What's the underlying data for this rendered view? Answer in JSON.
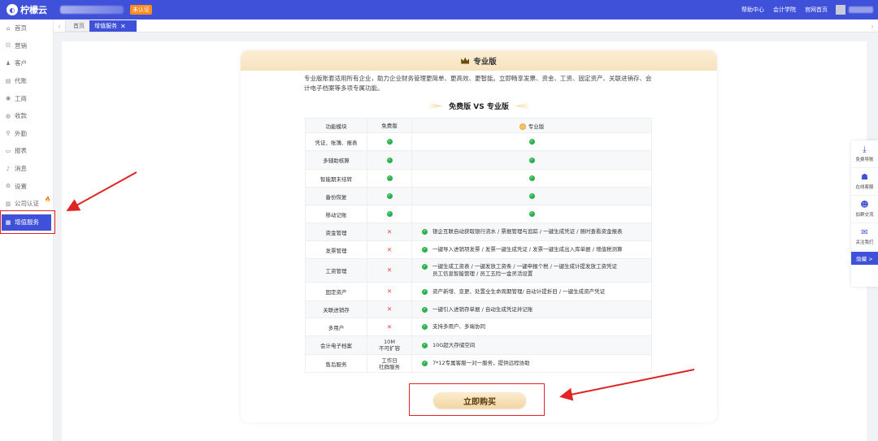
{
  "app": {
    "brand": "柠檬云",
    "badge": "未认证",
    "top_links": [
      "帮助中心",
      "会计学院",
      "官网首页"
    ]
  },
  "sidebar": {
    "items": [
      {
        "label": "首页",
        "icon": "home-icon",
        "glyph": "⌂"
      },
      {
        "label": "营销",
        "icon": "marketing-icon",
        "glyph": "☷"
      },
      {
        "label": "客户",
        "icon": "customer-icon",
        "glyph": "♟"
      },
      {
        "label": "代账",
        "icon": "bookkeeping-icon",
        "glyph": "▤"
      },
      {
        "label": "工商",
        "icon": "business-icon",
        "glyph": "◉"
      },
      {
        "label": "收款",
        "icon": "payment-icon",
        "glyph": "◍"
      },
      {
        "label": "外勤",
        "icon": "field-icon",
        "glyph": "⚲"
      },
      {
        "label": "报表",
        "icon": "report-icon",
        "glyph": "▭"
      },
      {
        "label": "消息",
        "icon": "bell-icon",
        "glyph": "♪"
      },
      {
        "label": "设置",
        "icon": "gear-icon",
        "glyph": "⚙"
      },
      {
        "label": "公司认证",
        "icon": "certify-icon",
        "glyph": "▥"
      },
      {
        "label": "增值服务",
        "icon": "value-added-icon",
        "glyph": "▦"
      }
    ]
  },
  "tabs": {
    "home": "首页",
    "current": "增值服务",
    "close": "✕",
    "prev": "‹",
    "next": "›"
  },
  "card": {
    "title": "专业版",
    "desc": "专业版账套适用所有企业，助力企业财务管理更简单、更高效、更智能。立即畅享发票、资金、工资、固定资产、关联进销存、会计电子档案等多项专属功能。",
    "vs_title": "免费版 VS 专业版",
    "headers": {
      "module": "功能模块",
      "free": "免费版",
      "pro": "专业版"
    },
    "rows": [
      {
        "module": "凭证、账簿、报表",
        "free": "check",
        "pro": "check",
        "pro_lines": []
      },
      {
        "module": "多辅助核算",
        "free": "check",
        "pro": "check",
        "pro_lines": []
      },
      {
        "module": "智能期末结转",
        "free": "check",
        "pro": "check",
        "pro_lines": []
      },
      {
        "module": "备份恢复",
        "free": "check",
        "pro": "check",
        "pro_lines": []
      },
      {
        "module": "移动记账",
        "free": "check",
        "pro": "check",
        "pro_lines": []
      },
      {
        "module": "资金管理",
        "free": "cross",
        "pro": "text",
        "pro_lines": [
          "银企互联自动获取银行流水 / 票据管理与追踪 / 一键生成凭证 / 随时查看资金报表"
        ]
      },
      {
        "module": "发票管理",
        "free": "cross",
        "pro": "text",
        "pro_lines": [
          "一键导入进销项发票 / 发票一键生成凭证 / 发票一键生成出入库单据 / 增值税测算"
        ]
      },
      {
        "module": "工资管理",
        "free": "cross",
        "pro": "text",
        "pro_lines": [
          "一键生成工资表 / 一键发放工资条 / 一键申报个税 / 一键生成计提发放工资凭证",
          "员工信息智能管理 / 员工五险一金灵活设置"
        ]
      },
      {
        "module": "固定资产",
        "free": "cross",
        "pro": "text",
        "pro_lines": [
          "资产新增、变更、处置全生命周期管理/ 自动计提折旧 / 一键生成资产凭证"
        ]
      },
      {
        "module": "关联进销存",
        "free": "cross",
        "pro": "text",
        "pro_lines": [
          "一键引入进销存单据 / 自动生成凭证并记账"
        ]
      },
      {
        "module": "多用户",
        "free": "cross",
        "pro": "text",
        "pro_lines": [
          "支持多用户、多端协同"
        ]
      },
      {
        "module": "会计电子档案",
        "free": "text",
        "free_lines": [
          "10M",
          "不可扩容"
        ],
        "pro": "text",
        "pro_lines": [
          "10G超大存储空间"
        ]
      },
      {
        "module": "售后服务",
        "free": "text",
        "free_lines": [
          "工作日",
          "社群服务"
        ],
        "pro": "text",
        "pro_lines": [
          "7*12专属客服一对一服务，提供远程协助"
        ]
      }
    ],
    "buy_label": "立即购买"
  },
  "float_panel": {
    "items": [
      {
        "label": "免费导账",
        "icon": "download-icon",
        "glyph": "⤓"
      },
      {
        "label": "在线客服",
        "icon": "service-icon",
        "glyph": "☗"
      },
      {
        "label": "加群交流",
        "icon": "group-icon",
        "glyph": "☻"
      },
      {
        "label": "关注我们",
        "icon": "wechat-icon",
        "glyph": "✉"
      }
    ],
    "collapse": "隐藏 >"
  },
  "colors": {
    "brand": "#3f51d9",
    "check": "#2bb24c",
    "cross": "#e4463b",
    "annotation": "#e02323",
    "gold": "#f2d6a4"
  }
}
